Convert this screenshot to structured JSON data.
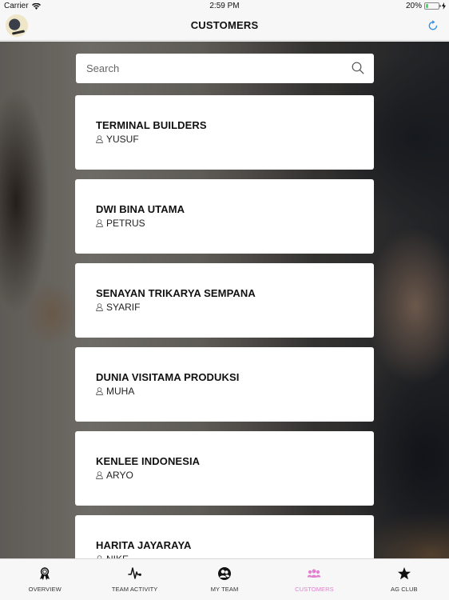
{
  "status_bar": {
    "carrier": "Carrier",
    "time": "2:59 PM",
    "battery_percent_label": "20%",
    "battery_level": 0.2
  },
  "nav_bar": {
    "title": "CUSTOMERS",
    "left_icon": "user-avatar",
    "right_icon": "refresh-icon"
  },
  "search": {
    "placeholder": "Search",
    "value": "",
    "icon": "search-icon"
  },
  "customers": [
    {
      "name": "TERMINAL BUILDERS",
      "contact": "YUSUF"
    },
    {
      "name": "DWI BINA UTAMA",
      "contact": "PETRUS"
    },
    {
      "name": "SENAYAN TRIKARYA SEMPANA",
      "contact": "SYARIF"
    },
    {
      "name": "DUNIA VISITAMA PRODUKSI",
      "contact": "MUHA"
    },
    {
      "name": "KENLEE INDONESIA",
      "contact": "ARYO"
    },
    {
      "name": "HARITA JAYARAYA",
      "contact": "NIKE"
    }
  ],
  "tab_bar": {
    "active_color": "#e27fd0",
    "tabs": [
      {
        "label": "OVERVIEW",
        "icon": "award-ribbon-icon",
        "active": false
      },
      {
        "label": "TEAM ACTIVITY",
        "icon": "pulse-icon",
        "active": false
      },
      {
        "label": "MY TEAM",
        "icon": "team-circle-icon",
        "active": false
      },
      {
        "label": "CUSTOMERS",
        "icon": "customers-group-icon",
        "active": true
      },
      {
        "label": "AG CLUB",
        "icon": "star-icon",
        "active": false
      }
    ]
  }
}
